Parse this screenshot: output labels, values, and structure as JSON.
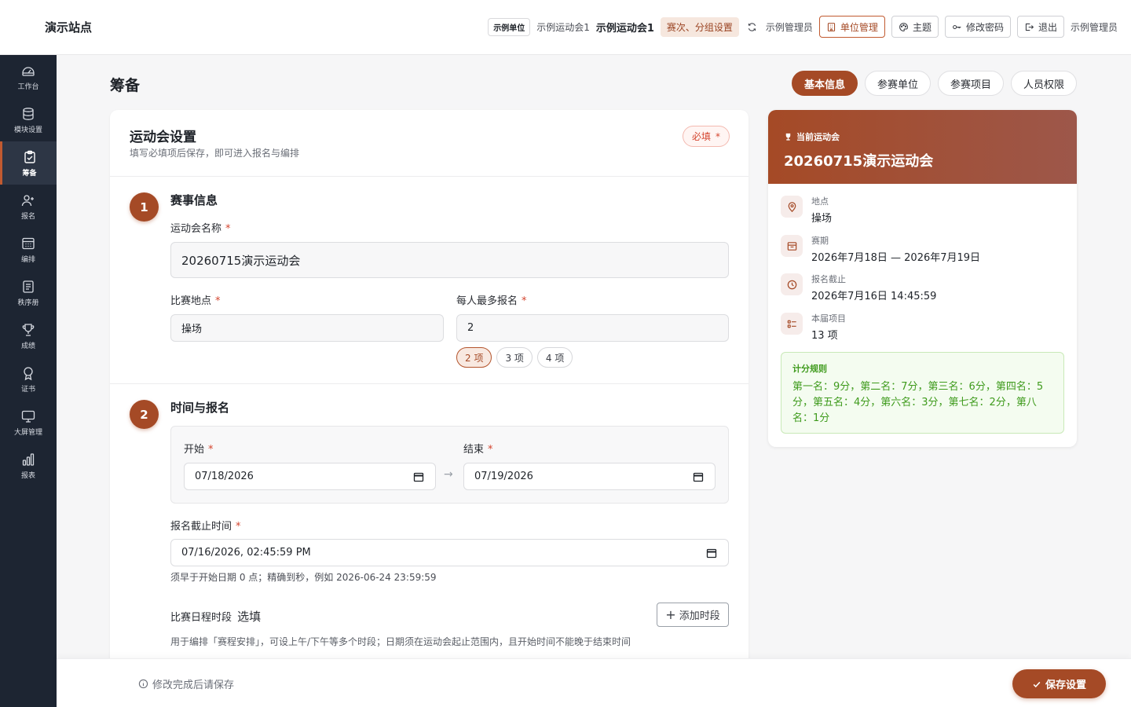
{
  "header": {
    "site_title": "演示站点",
    "unit_badge": "示例单位",
    "meet_small": "示例运动会1",
    "meet_current": "示例运动会1",
    "stage_tag": "赛次、分组设置",
    "admin_name": "示例管理员",
    "unit_manage_label": "单位管理",
    "theme_label": "主题",
    "change_password_label": "修改密码",
    "logout_label": "退出",
    "user_name": "示例管理员"
  },
  "sidebar": {
    "items": [
      {
        "label": "工作台",
        "icon": "dashboard-icon"
      },
      {
        "label": "模块设置",
        "icon": "database-icon"
      },
      {
        "label": "筹备",
        "icon": "clipboard-icon"
      },
      {
        "label": "报名",
        "icon": "user-add-icon"
      },
      {
        "label": "编排",
        "icon": "calendar-grid-icon"
      },
      {
        "label": "秩序册",
        "icon": "list-icon"
      },
      {
        "label": "成绩",
        "icon": "trophy-icon"
      },
      {
        "label": "证书",
        "icon": "medal-icon"
      },
      {
        "label": "大屏管理",
        "icon": "monitor-icon"
      },
      {
        "label": "报表",
        "icon": "bar-chart-icon"
      }
    ],
    "active_index": 2
  },
  "page": {
    "title": "筹备",
    "tabs": [
      "基本信息",
      "参赛单位",
      "参赛项目",
      "人员权限"
    ],
    "active_tab": 0
  },
  "form": {
    "card_title": "运动会设置",
    "card_subtitle": "填写必填项后保存，即可进入报名与编排",
    "required_pill": "必填",
    "required_mark": "*",
    "section1": {
      "number": "1",
      "title": "赛事信息",
      "name_label": "运动会名称",
      "name_value": "20260715演示运动会",
      "venue_label": "比赛地点",
      "venue_value": "操场",
      "max_label": "每人最多报名",
      "max_value": "2",
      "max_options": [
        "2 项",
        "3 项",
        "4 项"
      ],
      "max_selected": 0
    },
    "section2": {
      "number": "2",
      "title": "时间与报名",
      "start_label": "开始",
      "start_value": "07/18/2026",
      "end_label": "结束",
      "end_value": "07/19/2026",
      "deadline_label": "报名截止时间",
      "deadline_value": "07/16/2026, 02:45:59 PM",
      "deadline_hint": "须早于开始日期 0 点；精确到秒，例如 2026-06-24 23:59:59",
      "schedule_label": "比赛日程时段",
      "schedule_optional": "选填",
      "add_slot_label": "添加时段",
      "schedule_hint": "用于编排「赛程安排」，可设上午/下午等多个时段；日期须在运动会起止范围内，且开始时间不能晚于结束时间"
    }
  },
  "summary": {
    "kicker": "当前运动会",
    "name": "20260715演示运动会",
    "rows": [
      {
        "label": "地点",
        "value": "操场",
        "icon": "location-pin-icon"
      },
      {
        "label": "赛期",
        "value": "2026年7月18日 — 2026年7月19日",
        "icon": "calendar-icon"
      },
      {
        "label": "报名截止",
        "value": "2026年7月16日 14:45:59",
        "icon": "clock-icon"
      },
      {
        "label": "本届项目",
        "value": "13 项",
        "icon": "checklist-icon"
      }
    ],
    "rule_title": "计分规则",
    "rule_text": "第一名：9分，第二名：7分，第三名：6分，第四名：5分，第五名：4分，第六名：3分，第七名：2分，第八名：1分"
  },
  "footer": {
    "hint": "修改完成后请保存",
    "save_label": "保存设置"
  },
  "colors": {
    "accent": "#a54a26",
    "sidebar_bg": "#1d2532",
    "required": "#d4452f",
    "rule_green": "#3f9b1d"
  }
}
